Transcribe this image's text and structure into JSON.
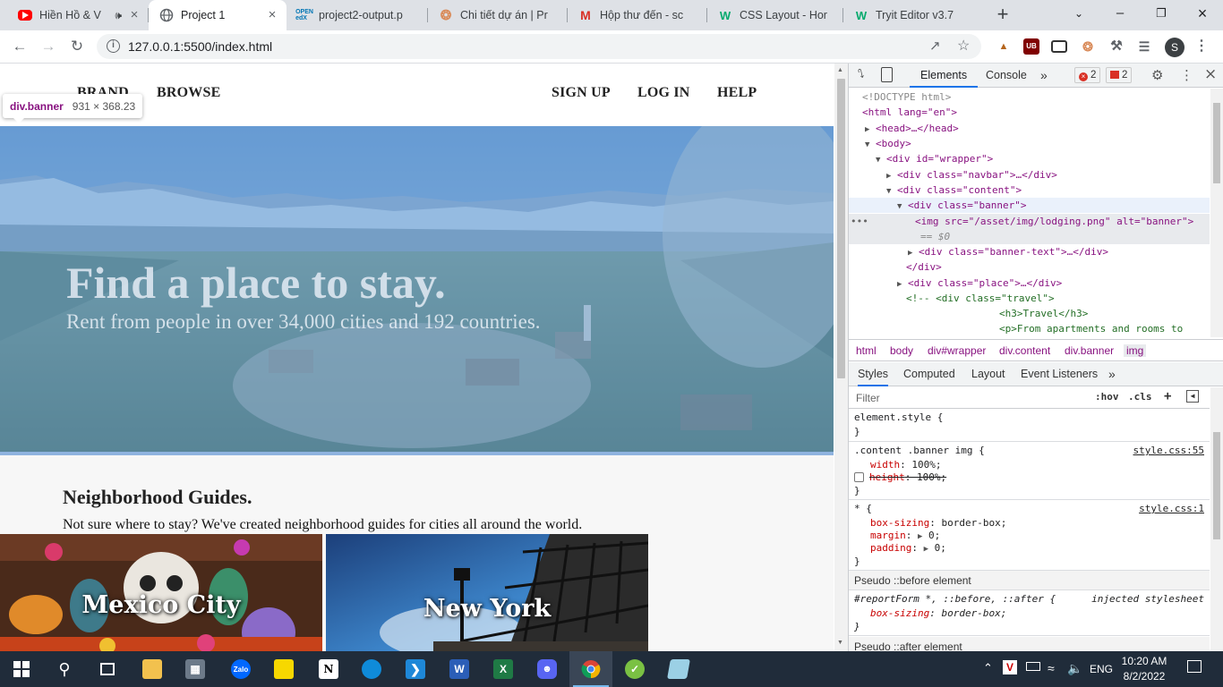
{
  "browser": {
    "tabs": [
      {
        "title": "Hiền Hồ & V",
        "favicon": "youtube-icon",
        "active": false
      },
      {
        "title": "Project 1",
        "favicon": "globe-icon",
        "active": true
      },
      {
        "title": "project2-output.p",
        "favicon": "openedx-icon",
        "active": false
      },
      {
        "title": "Chi tiết dự án | Pr",
        "favicon": "freelancer-icon",
        "active": false
      },
      {
        "title": "Hộp thư đến - sc",
        "favicon": "gmail-icon",
        "active": false
      },
      {
        "title": "CSS Layout - Hor",
        "favicon": "w3schools-icon",
        "active": false
      },
      {
        "title": "Tryit Editor v3.7",
        "favicon": "w3schools-icon",
        "active": false
      }
    ],
    "url": "127.0.0.1:5500/index.html",
    "profile_initial": "S",
    "ext_badge_ublock": "UB"
  },
  "page": {
    "nav": {
      "brand": "BRAND",
      "browse": "BROWSE",
      "signup": "SIGN UP",
      "login": "LOG IN",
      "help": "HELP"
    },
    "tooltip": {
      "tag": "div.banner",
      "size": "931 × 368.23"
    },
    "banner": {
      "title": "Find a place to stay.",
      "subtitle": "Rent from people in over 34,000 cities and 192 countries."
    },
    "guides": {
      "title": "Neighborhood Guides.",
      "desc": "Not sure where to stay? We've created neighborhood guides for cities all around the world.",
      "places": [
        {
          "name": "Mexico City"
        },
        {
          "name": "New York"
        }
      ]
    }
  },
  "devtools": {
    "tabs": [
      "Elements",
      "Console"
    ],
    "error_count": "2",
    "issue_count": "2",
    "dom": [
      {
        "t": "<!DOCTYPE html>"
      },
      {
        "t": "<html lang=\"en\">"
      },
      {
        "t": "<head>…</head>"
      },
      {
        "t": "<body>"
      },
      {
        "t": "<div id=\"wrapper\">"
      },
      {
        "t": "<div class=\"navbar\">…</div>"
      },
      {
        "t": "<div class=\"content\">"
      },
      {
        "t": "<div class=\"banner\">"
      },
      {
        "t": "<img src=\"/asset/img/lodging.png\" alt=\"banner\">"
      },
      {
        "t": "== $0"
      },
      {
        "t": "<div class=\"banner-text\">…</div>"
      },
      {
        "t": "</div>"
      },
      {
        "t": "<div class=\"place\">…</div>"
      },
      {
        "t": "<!-- <div class=\"travel\">"
      },
      {
        "t": "<h3>Travel</h3>"
      },
      {
        "t": "<p>From apartments and rooms to"
      }
    ],
    "breadcrumbs": [
      "html",
      "body",
      "div#wrapper",
      "div.content",
      "div.banner",
      "img"
    ],
    "style_tabs": [
      "Styles",
      "Computed",
      "Layout",
      "Event Listeners"
    ],
    "filter_placeholder": "Filter",
    "filter_tools": {
      "hov": ":hov",
      "cls": ".cls"
    },
    "rules": {
      "element": {
        "selector": "element.style {",
        "close": "}"
      },
      "banner_img": {
        "selector": ".content .banner img {",
        "source": "style.css:55",
        "p1": "width",
        "v1": "100%;",
        "p2": "height",
        "v2": "100%;",
        "close": "}"
      },
      "universal": {
        "selector": "* {",
        "source": "style.css:1",
        "p1": "box-sizing",
        "v1": "border-box;",
        "p2": "margin",
        "v2": "0;",
        "p3": "padding",
        "v3": "0;",
        "close": "}"
      },
      "pseudo_before_header": "Pseudo ::before element",
      "injected": {
        "selector": "#reportForm *, ::before, ::after {",
        "source": "injected stylesheet",
        "p1": "box-sizing",
        "v1": "border-box;",
        "close": "}"
      },
      "pseudo_after_header": "Pseudo ::after element"
    }
  },
  "taskbar": {
    "lang": "ENG",
    "time": "10:20 AM",
    "date": "8/2/2022",
    "zalo_label": "Zalo",
    "word_label": "W",
    "excel_label": "X"
  }
}
